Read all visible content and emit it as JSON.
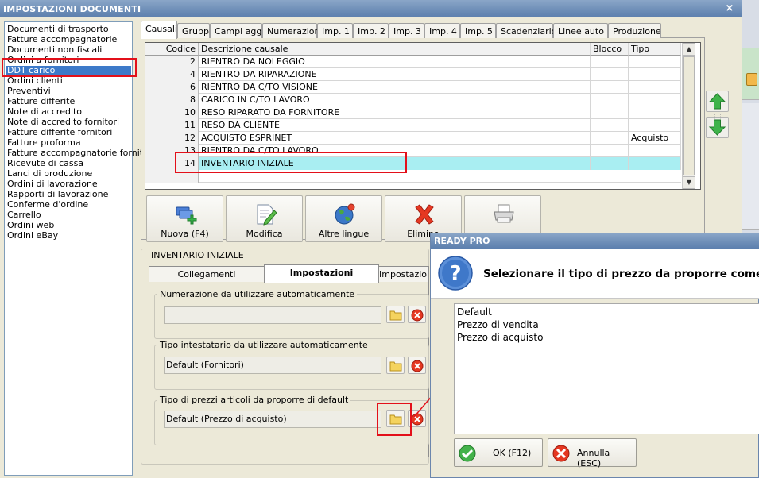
{
  "window": {
    "title": "IMPOSTAZIONI DOCUMENTI",
    "close_glyph": "×"
  },
  "doc_list": {
    "items": [
      "Documenti di trasporto",
      "Fatture accompagnatorie",
      "Documenti non fiscali",
      "Ordini a fornitori",
      "DDT carico",
      "Ordini clienti",
      "Preventivi",
      "Fatture differite",
      "Note di accredito",
      "Note di accredito fornitori",
      "Fatture differite fornitori",
      "Fatture proforma",
      "Fatture accompagnatorie fornitori",
      "Ricevute di cassa",
      "Lanci di produzione",
      "Ordini di lavorazione",
      "Rapporti di lavorazione",
      "Conferme d'ordine",
      "Carrello",
      "Ordini web",
      "Ordini eBay"
    ],
    "selected": "DDT carico"
  },
  "tabs": [
    "Causali",
    "Gruppi",
    "Campi agg.",
    "Numerazioni",
    "Imp. 1",
    "Imp. 2",
    "Imp. 3",
    "Imp. 4",
    "Imp. 5",
    "Scadenziario",
    "Linee auto",
    "Produzione"
  ],
  "grid": {
    "headers": {
      "code": "Codice",
      "desc": "Descrizione causale",
      "block": "Blocco",
      "type": "Tipo"
    },
    "rows": [
      {
        "code": "2",
        "desc": "RIENTRO DA NOLEGGIO",
        "block": "",
        "type": ""
      },
      {
        "code": "4",
        "desc": "RIENTRO DA RIPARAZIONE",
        "block": "",
        "type": ""
      },
      {
        "code": "6",
        "desc": "RIENTRO DA C/TO VISIONE",
        "block": "",
        "type": ""
      },
      {
        "code": "8",
        "desc": "CARICO IN C/TO LAVORO",
        "block": "",
        "type": ""
      },
      {
        "code": "10",
        "desc": "RESO RIPARATO DA FORNITORE",
        "block": "",
        "type": ""
      },
      {
        "code": "11",
        "desc": "RESO DA CLIENTE",
        "block": "",
        "type": ""
      },
      {
        "code": "12",
        "desc": "ACQUISTO ESPRINET",
        "block": "",
        "type": "Acquisto"
      },
      {
        "code": "13",
        "desc": "RIENTRO DA C/TO LAVORO",
        "block": "",
        "type": ""
      },
      {
        "code": "14",
        "desc": "INVENTARIO INIZIALE",
        "block": "",
        "type": ""
      }
    ],
    "selected_code": "14"
  },
  "toolbar": {
    "new_label": "Nuova (F4)",
    "edit_label": "Modifica",
    "languages_label": "Altre lingue",
    "delete_label": "Elimina"
  },
  "detail": {
    "group_title": "INVENTARIO INIZIALE",
    "subtabs": {
      "links": "Collegamenti",
      "settings": "Impostazioni",
      "more": "Impostazioni"
    },
    "numbering": {
      "label": "Numerazione da utilizzare automaticamente",
      "value": ""
    },
    "holder": {
      "label": "Tipo intestatario da utilizzare automaticamente",
      "value": "Default (Fornitori)"
    },
    "price": {
      "label": "Tipo di prezzi articoli da proporre di default",
      "value": "Default (Prezzo di acquisto)"
    }
  },
  "dialog": {
    "title": "READY PRO",
    "question": "Selezionare il tipo di prezzo da proporre come",
    "options": [
      "Default",
      "Prezzo di vendita",
      "Prezzo di acquisto"
    ],
    "ok_label": "OK (F12)",
    "cancel_label": "Annulla (ESC)"
  },
  "colors": {
    "highlight": "#e3101a",
    "selection_row": "#a9eef2",
    "list_selection": "#3d7ac9",
    "title_bar": "#6f8fb8"
  }
}
